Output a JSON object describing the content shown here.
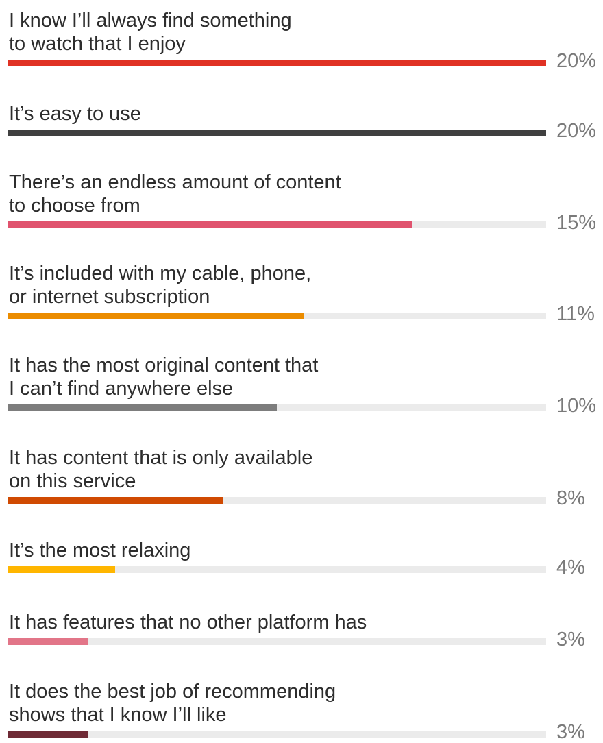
{
  "chart_data": {
    "type": "bar",
    "orientation": "horizontal",
    "title": "",
    "xlabel": "",
    "ylabel": "",
    "xlim": [
      0,
      20
    ],
    "grid": false,
    "legend": "none",
    "categories": [
      "I know I’ll always find something\nto watch that I enjoy",
      "It’s easy to use",
      "There’s an endless amount of content\nto choose from",
      "It’s included with my cable, phone,\nor internet subscription",
      "It has the most original content that\nI can’t find anywhere else",
      "It has content that is only available\non this service",
      "It’s the most relaxing",
      "It has features that no other platform has",
      "It does the best job of recommending\nshows that I know I’ll like"
    ],
    "values": [
      20,
      20,
      15,
      11,
      10,
      8,
      4,
      3,
      3
    ],
    "value_labels": [
      "20%",
      "20%",
      "15%",
      "11%",
      "10%",
      "8%",
      "4%",
      "3%",
      "3%"
    ],
    "colors": [
      "#e03224",
      "#404040",
      "#e0536e",
      "#eb8c00",
      "#7d7d7d",
      "#d04a02",
      "#ffb600",
      "#e27588",
      "#6e2a35"
    ],
    "track_color": "#ebebeb"
  }
}
